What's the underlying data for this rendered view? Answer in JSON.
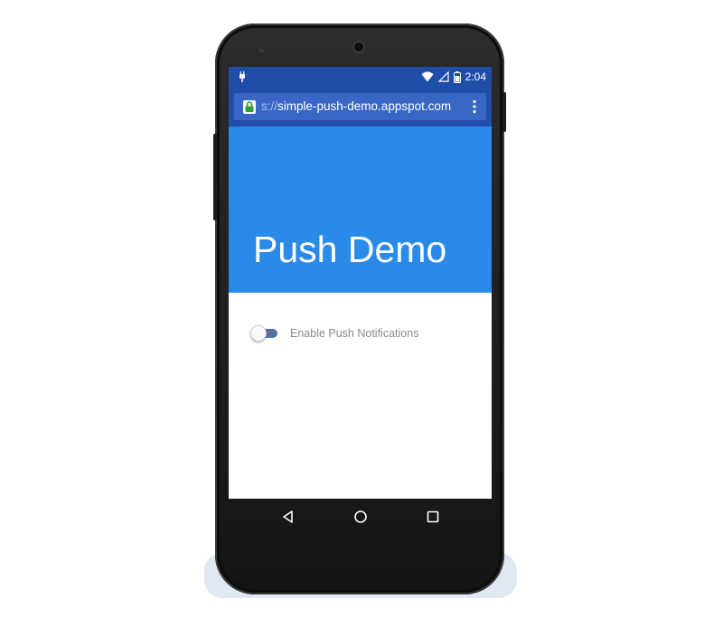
{
  "status_bar": {
    "time": "2:04",
    "icons": [
      "android-notification-icon",
      "wifi-icon",
      "signal-icon",
      "battery-icon"
    ]
  },
  "browser": {
    "url_scheme": "s://",
    "url_host": "simple-push-demo.appspot.com",
    "icons": [
      "lock-icon",
      "overflow-menu-icon"
    ]
  },
  "page": {
    "title": "Push Demo",
    "toggle_label": "Enable Push Notifications",
    "toggle_enabled": false
  },
  "nav_bar": {
    "icons": [
      "back-icon",
      "home-icon",
      "recents-icon"
    ]
  },
  "colors": {
    "status_bar": "#1f4da8",
    "omnibox": "#3a67c6",
    "hero": "#2a8ae8",
    "switch_track": "#5b6fa3",
    "label_text": "#8a8a8a"
  }
}
